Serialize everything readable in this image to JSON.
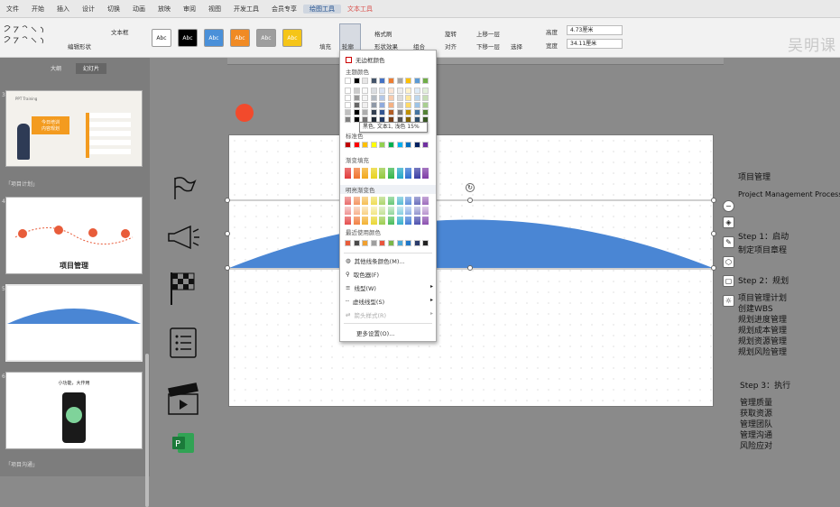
{
  "menubar": {
    "items": [
      "文件",
      "开始",
      "插入",
      "设计",
      "切换",
      "动画",
      "放映",
      "审阅",
      "视图",
      "开发工具",
      "会员专享",
      "绘图工具",
      "文本工具"
    ],
    "active_index": 11,
    "context_index": 12
  },
  "brand": {
    "text": "吴明课"
  },
  "ribbon": {
    "style_labels": [
      "Abc",
      "Abc",
      "Abc",
      "Abc",
      "Abc",
      "Abc"
    ],
    "style_colors": [
      "#ffffff",
      "#000000",
      "#4a90d9",
      "#f08a24",
      "#9e9e9e",
      "#f5c518"
    ],
    "style_text_colors": [
      "#222222",
      "#ffffff",
      "#ffffff",
      "#ffffff",
      "#ffffff",
      "#ffffff"
    ],
    "fill_label": "填充",
    "outline_label": "轮廓",
    "format_brush": "格式刷",
    "shape_effect": "形状效果",
    "text_box": "文本框",
    "edit_shape": "编辑形状",
    "combine": "组合",
    "align": "对齐",
    "rotate": "旋转",
    "up_layer": "上移一层",
    "down_layer": "下移一层",
    "select": "选择",
    "height_label": "高度",
    "height_value": "4.73厘米",
    "width_label": "宽度",
    "width_value": "34.11厘米"
  },
  "leftpanel": {
    "tabs": [
      "大纲",
      "幻灯片"
    ],
    "active_tab": 1,
    "thumb1": {
      "title": "今日培训\n内容规划",
      "tag": "PPT Training"
    },
    "section1": "「项目计划」",
    "thumb2": {
      "title": "项目管理"
    },
    "thumb4": {
      "title": "小功能，大作用"
    },
    "section2": "「项目沟通」",
    "slide_numbers": [
      "3",
      "4",
      "5",
      "6"
    ]
  },
  "dropdown": {
    "no_outline": "无边框颜色",
    "theme_colors": "主题颜色",
    "standard_colors": "标准色",
    "gradient_fill": "渐变填充",
    "light_gradient": "明亮渐变色",
    "recent_colors": "最近使用颜色",
    "other_colors": "其他线条颜色(M)...",
    "picker": "取色器(F)",
    "line_style": "线型(W)",
    "dash_style": "虚线线型(S)",
    "arrow_style": "箭头样式(R)",
    "more_settings": "更多设置(O)...",
    "theme_top_row": [
      "#ffffff",
      "#000000",
      "#e7e6e6",
      "#44546a",
      "#4472c4",
      "#ed7d31",
      "#a5a5a5",
      "#ffc000",
      "#5b9bd5",
      "#70ad47"
    ],
    "standard_row": [
      "#c00000",
      "#ff0000",
      "#ffc000",
      "#ffff00",
      "#92d050",
      "#00b050",
      "#00b0f0",
      "#0070c0",
      "#002060",
      "#7030a0"
    ],
    "gradient_row": [
      "#e23b3b",
      "#f0732e",
      "#f2a91c",
      "#e8d21d",
      "#92c83e",
      "#36b54a",
      "#23a6c6",
      "#2e6fd1",
      "#3b3fa5",
      "#7e3ca6"
    ],
    "recent_row": [
      "#e85c3a",
      "#4a4a4a",
      "#f0a030",
      "#9e9e9e",
      "#e8553d",
      "#7ab648",
      "#4aa7d8",
      "#1f78c8",
      "#2b3b6a",
      "#222222"
    ]
  },
  "tooltip": {
    "text": "黑色, 文本1, 浅色 15%"
  },
  "notes": {
    "line1": "项目管理",
    "line2": "Project Management Process",
    "step1": "Step 1：启动",
    "step1_a": "制定项目章程",
    "step2": "Step 2：规划",
    "step2_a": "项目管理计划",
    "step2_b": "创建WBS",
    "step2_c": "规划进度管理",
    "step2_d": "规划成本管理",
    "step2_e": "规划资源管理",
    "step2_f": "规划风险管理",
    "step3": "Step 3：执行",
    "step3_a": "管理质量",
    "step3_b": "获取资源",
    "step3_c": "管理团队",
    "step3_d": "管理沟通",
    "step3_e": "风险应对"
  },
  "colors": {
    "shape_fill": "#4a86d4",
    "accent_red": "#f24a2c"
  }
}
